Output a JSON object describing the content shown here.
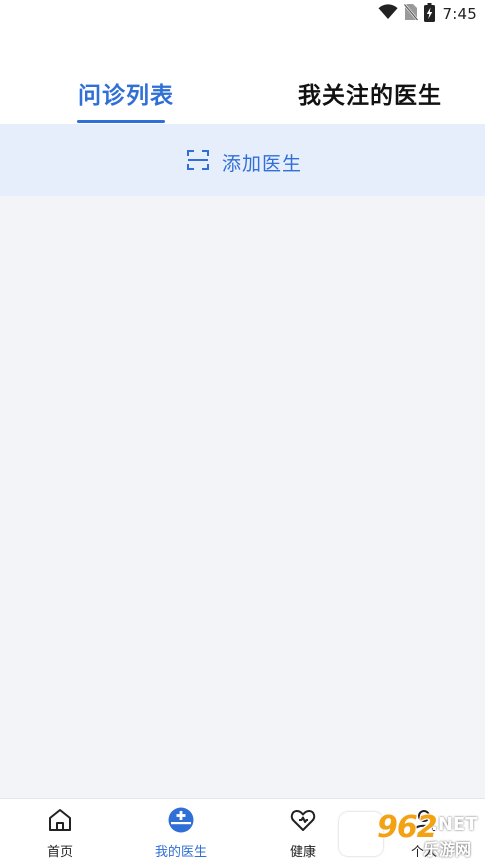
{
  "status_bar": {
    "time": "7:45",
    "icons": [
      "wifi-icon",
      "no-sim-icon",
      "battery-charging-icon"
    ]
  },
  "tabs": [
    {
      "label": "问诊列表",
      "active": true
    },
    {
      "label": "我关注的医生",
      "active": false
    }
  ],
  "add_doctor": {
    "label": "添加医生",
    "icon": "scan-icon"
  },
  "bottom_nav": {
    "items": [
      {
        "label": "首页",
        "icon": "home-icon",
        "active": false
      },
      {
        "label": "我的医生",
        "icon": "doctor-icon",
        "active": true
      },
      {
        "label": "健康",
        "icon": "heart-icon",
        "active": false
      },
      {
        "label": "个人",
        "icon": "person-icon",
        "active": false
      }
    ]
  },
  "watermark": {
    "number": "962",
    "domain": ".NET",
    "name": "乐游网"
  },
  "colors": {
    "accent": "#2f6fd6",
    "add_bar_bg": "#e6eefc",
    "content_bg": "#f2f4f8"
  }
}
